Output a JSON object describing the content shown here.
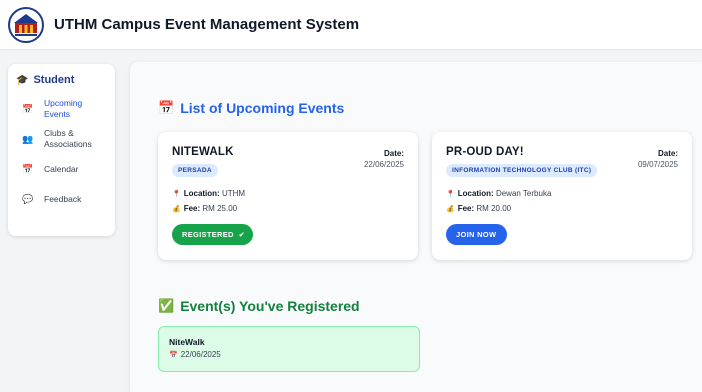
{
  "header": {
    "title": "UTHM Campus Event Management System",
    "logo_icon": "uthm-logo"
  },
  "sidebar": {
    "heading": "Student",
    "heading_icon": "graduation-cap-icon",
    "items": [
      {
        "label": "Upcoming Events",
        "icon": "calendar-icon",
        "active": true
      },
      {
        "label": "Clubs & Associations",
        "icon": "people-icon",
        "active": false
      },
      {
        "label": "Calendar",
        "icon": "calendar-icon",
        "active": false
      },
      {
        "label": "Feedback",
        "icon": "speech-bubble-icon",
        "active": false
      }
    ]
  },
  "main": {
    "upcoming_title": "List of Upcoming Events",
    "registered_title": "Event(s) You've Registered",
    "events": [
      {
        "name": "NITEWALK",
        "club": "PERSADA",
        "date_label": "Date:",
        "date": "22/06/2025",
        "location_label": "Location:",
        "location": "UTHM",
        "fee_label": "Fee:",
        "fee": "RM 25.00",
        "action": "REGISTERED",
        "action_color": "#16a34a"
      },
      {
        "name": "PR-OUD DAY!",
        "club": "INFORMATION TECHNOLOGY CLUB (ITC)",
        "date_label": "Date:",
        "date": "09/07/2025",
        "location_label": "Location:",
        "location": "Dewan Terbuka",
        "fee_label": "Fee:",
        "fee": "RM 20.00",
        "action": "JOIN NOW",
        "action_color": "#2563eb"
      }
    ],
    "registered": [
      {
        "name": "NiteWalk",
        "date": "22/06/2025"
      }
    ]
  },
  "colors": {
    "primary": "#2563eb",
    "success": "#16a34a",
    "badge_bg": "#dbeafe",
    "registered_bg": "#dcfce7"
  }
}
